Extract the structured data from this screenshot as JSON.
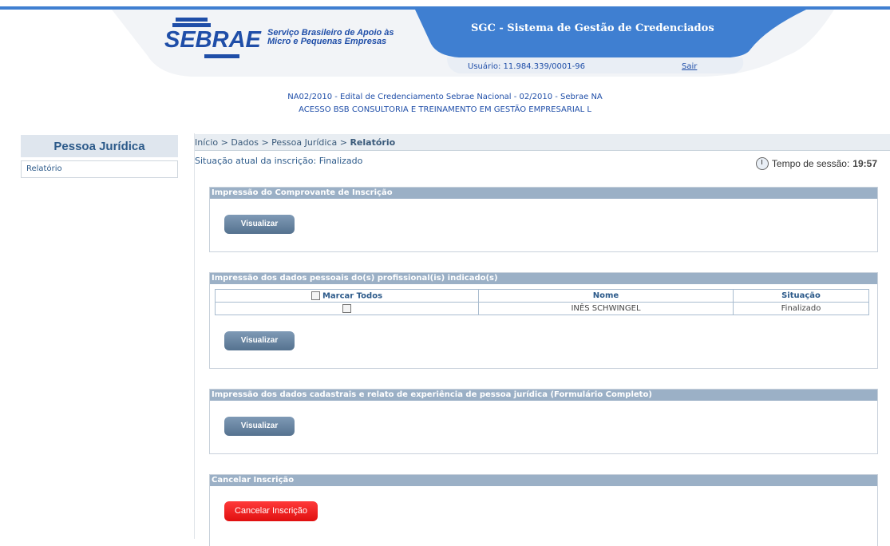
{
  "header": {
    "logo_word": "SEBRAE",
    "logo_sub_1": "Serviço Brasileiro de Apoio às",
    "logo_sub_2": "Micro e Pequenas Empresas",
    "system_title": "SGC - Sistema de Gestão de Credenciados",
    "user_label": "Usuário: 11.984.339/0001-96",
    "logout": "Sair",
    "edital_line_1": "NA02/2010 - Edital de Credenciamento Sebrae Nacional - 02/2010 - Sebrae NA",
    "edital_line_2": "ACESSO BSB CONSULTORIA E TREINAMENTO EM GESTÃO EMPRESARIAL L"
  },
  "sidebar": {
    "title": "Pessoa Jurídica",
    "items": [
      {
        "label": "Relatório"
      }
    ]
  },
  "breadcrumb": {
    "path": "Início > Dados > Pessoa Jurídica > ",
    "current": "Relatório"
  },
  "status": "Situação atual da inscrição: Finalizado",
  "session": {
    "label": "Tempo de sessão:",
    "value": "19:57"
  },
  "panels": {
    "comprovante": {
      "title": "Impressão do Comprovante de Inscrição",
      "button": "Visualizar"
    },
    "profissionais": {
      "title": "Impressão dos dados pessoais do(s) profissional(is) indicado(s)",
      "columns": {
        "select_all": "Marcar Todos",
        "name": "Nome",
        "status": "Situação"
      },
      "rows": [
        {
          "name": "INÊS SCHWINGEL",
          "status": "Finalizado",
          "checked": false
        }
      ],
      "button": "Visualizar"
    },
    "cadastrais": {
      "title": "Impressão dos dados cadastrais e relato de experiência de pessoa jurídica (Formulário Completo)",
      "button": "Visualizar"
    },
    "cancelar": {
      "title": "Cancelar Inscrição",
      "button": "Cancelar Inscrição"
    }
  },
  "colors": {
    "brand_blue": "#1f4ea8",
    "header_bar": "#9bb0c6",
    "danger": "#e01010"
  }
}
